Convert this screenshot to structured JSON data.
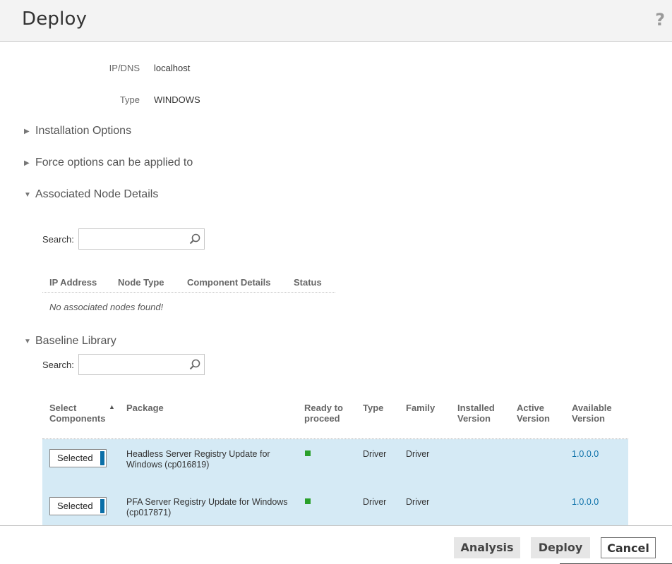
{
  "header": {
    "title": "Deploy",
    "help": "?"
  },
  "properties": [
    {
      "label": "IP/DNS",
      "value": "localhost"
    },
    {
      "label": "Type",
      "value": "WINDOWS"
    }
  ],
  "sections": {
    "installation_options": "Installation Options",
    "force_options": "Force options can be applied to",
    "associated_node_details": "Associated Node Details",
    "baseline_library": "Baseline Library"
  },
  "node_search": {
    "label": "Search:",
    "value": ""
  },
  "nodes_table": {
    "columns": [
      "IP Address",
      "Node Type",
      "Component Details",
      "Status"
    ],
    "empty_text": "No associated nodes found!"
  },
  "baseline_search": {
    "label": "Search:",
    "value": ""
  },
  "baseline_table": {
    "columns": {
      "select": "Select Components",
      "package": "Package",
      "ready": "Ready to proceed",
      "type": "Type",
      "family": "Family",
      "installed": "Installed Version",
      "active": "Active Version",
      "available": "Available Version"
    },
    "rows": [
      {
        "select": "Selected",
        "package": "Headless Server Registry Update for Windows (cp016819)",
        "ready_color": "#2aa02a",
        "type": "Driver",
        "family": "Driver",
        "installed": "",
        "active": "",
        "available": "1.0.0.0"
      },
      {
        "select": "Selected",
        "package": "PFA Server Registry Update for Windows (cp017871)",
        "ready_color": "#2aa02a",
        "type": "Driver",
        "family": "Driver",
        "installed": "",
        "active": "",
        "available": "1.0.0.0"
      }
    ]
  },
  "footer": {
    "analysis": "Analysis",
    "deploy": "Deploy",
    "cancel": "Cancel"
  }
}
